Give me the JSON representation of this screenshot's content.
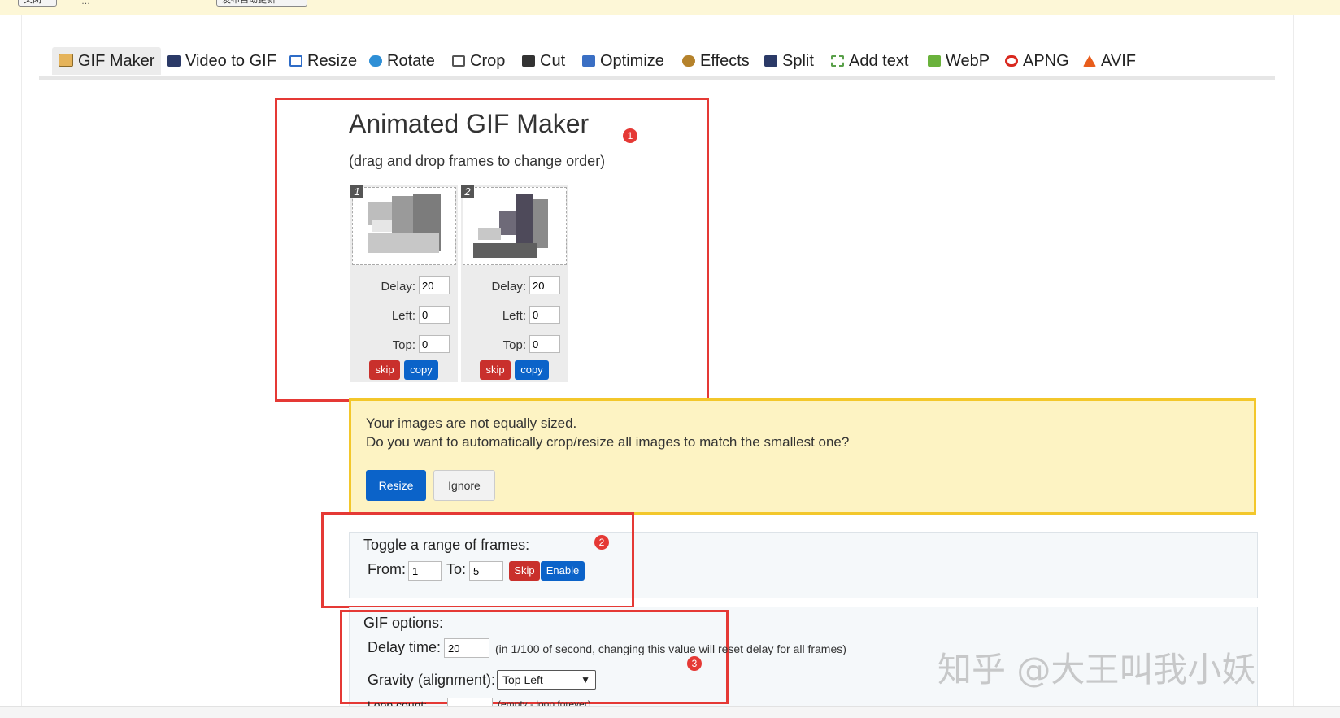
{
  "topbar": {
    "left_button": "关闭",
    "middle_text": "…",
    "right_button": "发布自动更新"
  },
  "tabs": [
    {
      "label": "GIF Maker",
      "icon": "gif-maker-icon",
      "color": "#c98a2a",
      "active": true
    },
    {
      "label": "Video to GIF",
      "icon": "film-icon",
      "color": "#2b3a67",
      "active": false
    },
    {
      "label": "Resize",
      "icon": "resize-icon",
      "color": "#2e6cc7",
      "active": false
    },
    {
      "label": "Rotate",
      "icon": "rotate-icon",
      "color": "#2e8fd6",
      "active": false
    },
    {
      "label": "Crop",
      "icon": "crop-icon",
      "color": "#555555",
      "active": false
    },
    {
      "label": "Cut",
      "icon": "cut-icon",
      "color": "#333333",
      "active": false
    },
    {
      "label": "Optimize",
      "icon": "optimize-icon",
      "color": "#3a6fc4",
      "active": false
    },
    {
      "label": "Effects",
      "icon": "effects-icon",
      "color": "#b5822b",
      "active": false
    },
    {
      "label": "Split",
      "icon": "split-icon",
      "color": "#2b3a67",
      "active": false
    },
    {
      "label": "Add text",
      "icon": "add-text-icon",
      "color": "#5aa04a",
      "active": false
    },
    {
      "label": "WebP",
      "icon": "webp-icon",
      "color": "#6ab23c",
      "active": false
    },
    {
      "label": "APNG",
      "icon": "apng-icon",
      "color": "#d9281e",
      "active": false
    },
    {
      "label": "AVIF",
      "icon": "avif-icon",
      "color": "#e85d1c",
      "active": false
    }
  ],
  "maker": {
    "title": "Animated GIF Maker",
    "subtitle": "(drag and drop frames to change order)",
    "badge": "1"
  },
  "frames": [
    {
      "number": "1",
      "delay_label": "Delay:",
      "delay": "20",
      "left_label": "Left:",
      "left": "0",
      "top_label": "Top:",
      "top": "0",
      "skip_label": "skip",
      "copy_label": "copy"
    },
    {
      "number": "2",
      "delay_label": "Delay:",
      "delay": "20",
      "left_label": "Left:",
      "left": "0",
      "top_label": "Top:",
      "top": "0",
      "skip_label": "skip",
      "copy_label": "copy"
    }
  ],
  "warning": {
    "line1": "Your images are not equally sized.",
    "line2": "Do you want to automatically crop/resize all images to match the smallest one?",
    "resize_label": "Resize",
    "ignore_label": "Ignore"
  },
  "toggle_range": {
    "title": "Toggle a range of frames:",
    "from_label": "From:",
    "from_value": "1",
    "to_label": "To:",
    "to_value": "5",
    "skip_label": "Skip",
    "enable_label": "Enable",
    "badge": "2"
  },
  "gif_options": {
    "title": "GIF options:",
    "delay_label": "Delay time:",
    "delay_value": "20",
    "delay_note": "(in 1/100 of second, changing this value will reset delay for all frames)",
    "gravity_label": "Gravity (alignment):",
    "gravity_value": "Top Left",
    "loop_label": "Loop count:",
    "loop_note": "(empty - loop forever)",
    "badge": "3"
  },
  "watermark": "知乎 @大王叫我小妖",
  "colors": {
    "annotation_red": "#e53935",
    "warning_border": "#f3c72b",
    "primary_blue": "#0b63c9",
    "danger_red": "#c9302c"
  }
}
